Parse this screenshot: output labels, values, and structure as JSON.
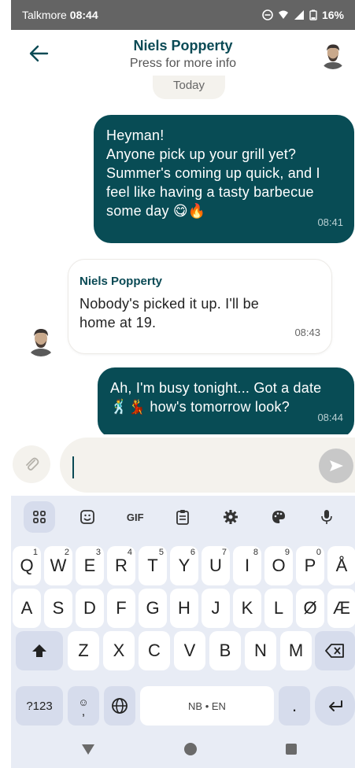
{
  "status_bar": {
    "app_name": "Talkmore",
    "time": "08:44",
    "battery": "16%"
  },
  "header": {
    "contact_name": "Niels Popperty",
    "subtitle": "Press for more info"
  },
  "chat": {
    "date_divider": "Today",
    "messages": [
      {
        "direction": "outgoing",
        "text": "Heyman!\nAnyone pick up your grill yet?\nSummer's coming up quick, and I\nfeel like having a tasty barbecue\nsome day 😋🔥",
        "time": "08:41"
      },
      {
        "direction": "incoming",
        "sender": "Niels Popperty",
        "text": "Nobody's picked it up. I'll be\nhome at 19.",
        "time": "08:43"
      },
      {
        "direction": "outgoing",
        "text": "Ah, I'm busy tonight... Got a date\n🕺💃 how's tomorrow look?",
        "time": "08:44"
      }
    ]
  },
  "composer": {
    "value": ""
  },
  "keyboard": {
    "toolbar": [
      "apps-grid-icon",
      "sticker-icon",
      "GIF",
      "clipboard-icon",
      "settings-icon",
      "palette-icon",
      "mic-icon"
    ],
    "gif_label": "GIF",
    "row1": [
      {
        "key": "Q",
        "hint": "1"
      },
      {
        "key": "W",
        "hint": "2"
      },
      {
        "key": "E",
        "hint": "3"
      },
      {
        "key": "R",
        "hint": "4"
      },
      {
        "key": "T",
        "hint": "5"
      },
      {
        "key": "Y",
        "hint": "6"
      },
      {
        "key": "U",
        "hint": "7"
      },
      {
        "key": "I",
        "hint": "8"
      },
      {
        "key": "O",
        "hint": "9"
      },
      {
        "key": "P",
        "hint": "0"
      },
      {
        "key": "Å",
        "hint": ""
      }
    ],
    "row2": [
      "A",
      "S",
      "D",
      "F",
      "G",
      "H",
      "J",
      "K",
      "L",
      "Ø",
      "Æ"
    ],
    "row3": [
      "Z",
      "X",
      "C",
      "V",
      "B",
      "N",
      "M"
    ],
    "symbols_label": "?123",
    "comma": ",",
    "space_label": "NB • EN",
    "period": "."
  },
  "colors": {
    "accent": "#084c55",
    "bubble_in_bg": "#ffffff",
    "cream": "#f4f2ed",
    "keyboard_bg": "#e8ecf5",
    "keyboard_mod": "#d6dcec"
  }
}
